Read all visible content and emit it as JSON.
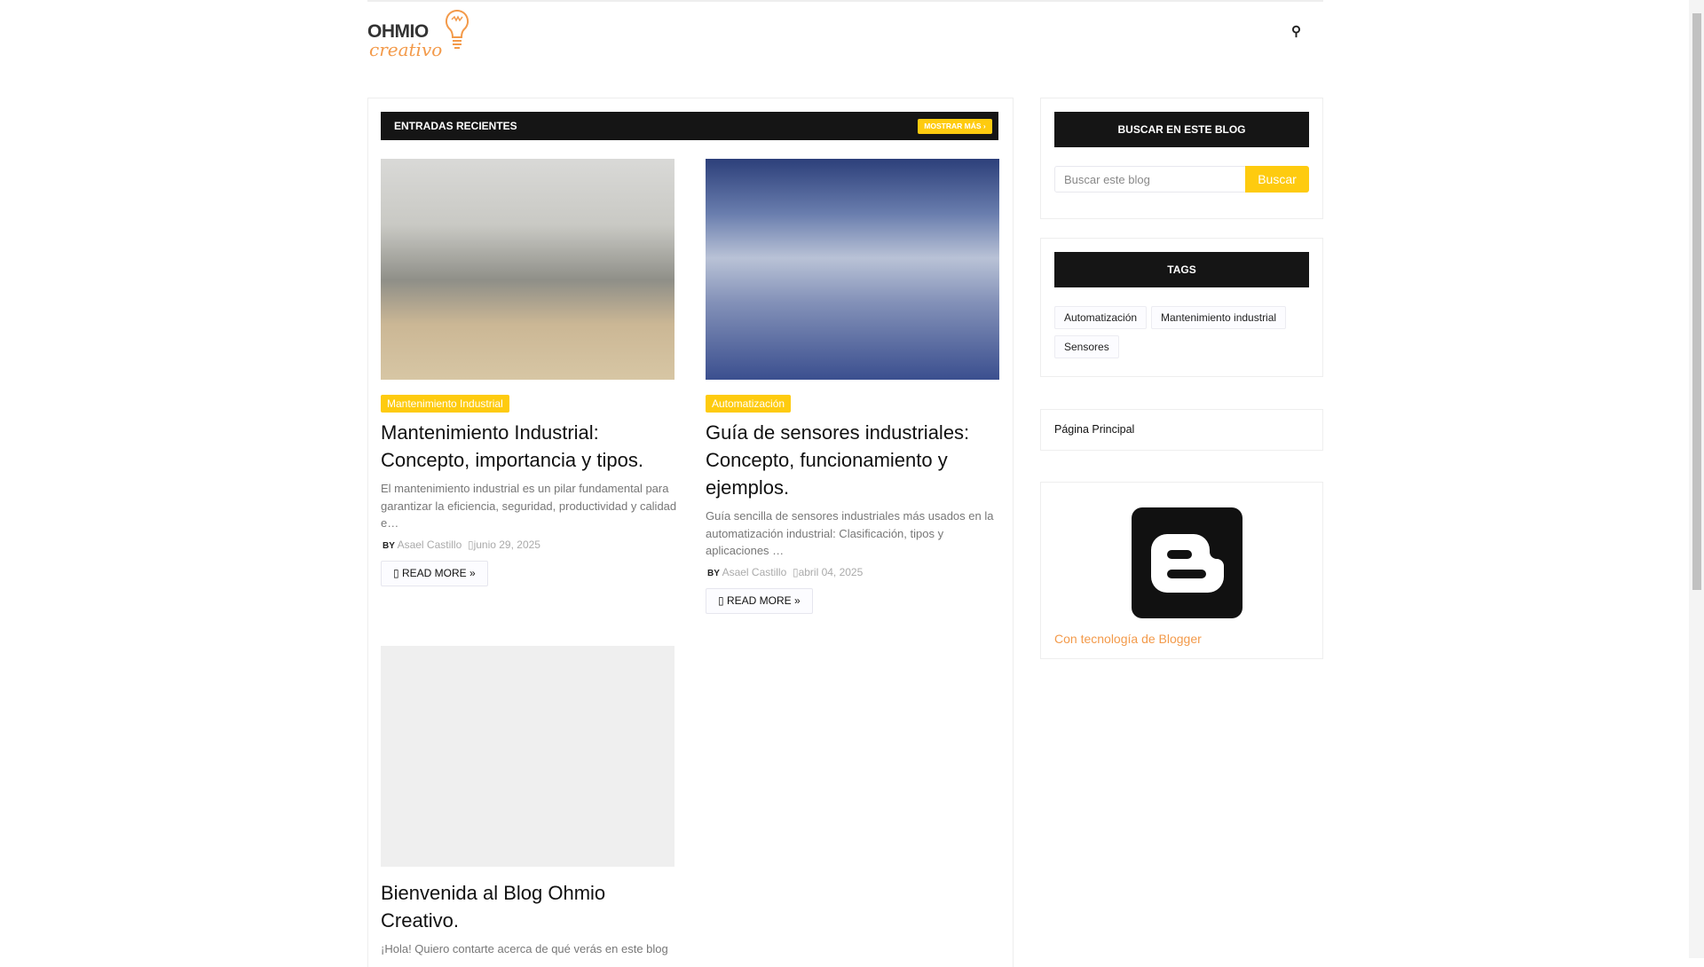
{
  "header": {
    "logo_text_top": "OHMIO",
    "logo_text_bottom": "creativo",
    "search_icon": "search-icon"
  },
  "recent": {
    "title": "ENTRADAS RECIENTES",
    "more_label": "MOSTRAR MÁS ›"
  },
  "posts": [
    {
      "label": "Mantenimiento Industrial",
      "title": "Mantenimiento Industrial: Concepto, importancia y tipos.",
      "excerpt": "El mantenimiento industrial es un pilar fundamental para garantizar la eficiencia, seguridad, productividad y calidad e…",
      "by": "BY",
      "author": "Asael Castillo",
      "date": "junio 29, 2025",
      "read_more": "READ MORE »"
    },
    {
      "label": "Automatización",
      "title": "Guía de sensores industriales: Concepto, funcionamiento y ejemplos.",
      "excerpt": "Guía sencilla de sensores industriales más usados en la automatización industrial: Clasificación, tipos y aplicaciones …",
      "by": "BY",
      "author": "Asael Castillo",
      "date": "abril 04, 2025",
      "read_more": "READ MORE »"
    },
    {
      "title": "Bienvenida al Blog Ohmio Creativo.",
      "excerpt": "¡Hola! Quiero contarte acerca de qué verás en este blog"
    }
  ],
  "sidebar": {
    "search": {
      "title": "BUSCAR EN ESTE BLOG",
      "placeholder": "Buscar este blog",
      "button": "Buscar"
    },
    "tags": {
      "title": "TAGS",
      "items": [
        "Automatización",
        "Mantenimiento industrial",
        "Sensores"
      ]
    },
    "pages": {
      "home": "Página Principal"
    },
    "attribution": {
      "link": "Con tecnología de Blogger"
    }
  },
  "colors": {
    "accent": "#fecb0f",
    "dark": "#151515",
    "link": "#f39a4a"
  }
}
